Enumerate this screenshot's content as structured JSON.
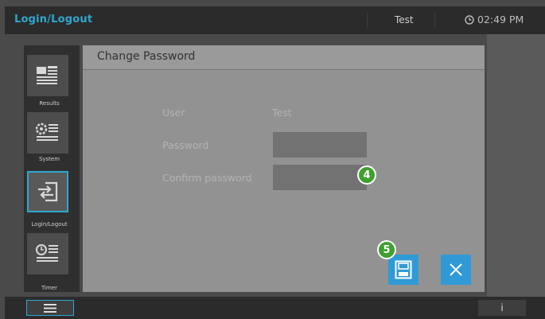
{
  "header": {
    "title": "Login/Logout",
    "user": "Test",
    "time": "02:49 PM"
  },
  "sidebar": {
    "items": [
      {
        "label": "Results",
        "icon": "results-icon",
        "active": false
      },
      {
        "label": "System",
        "icon": "system-icon",
        "active": false
      },
      {
        "label": "Login/Logout",
        "icon": "login-logout-icon",
        "active": true
      },
      {
        "label": "Timer",
        "icon": "timer-icon",
        "active": false
      }
    ]
  },
  "dialog": {
    "title": "Change Password",
    "user_label": "User",
    "user_value": "Test",
    "password_label": "Password",
    "password_value": "",
    "confirm_label": "Confirm password",
    "confirm_value": ""
  },
  "annotations": {
    "badge_4": "4",
    "badge_5": "5"
  },
  "footer": {
    "info_label": "i"
  },
  "colors": {
    "accent": "#2ea8cf",
    "button": "#2f9ad6",
    "badge": "#3f9f2f"
  }
}
